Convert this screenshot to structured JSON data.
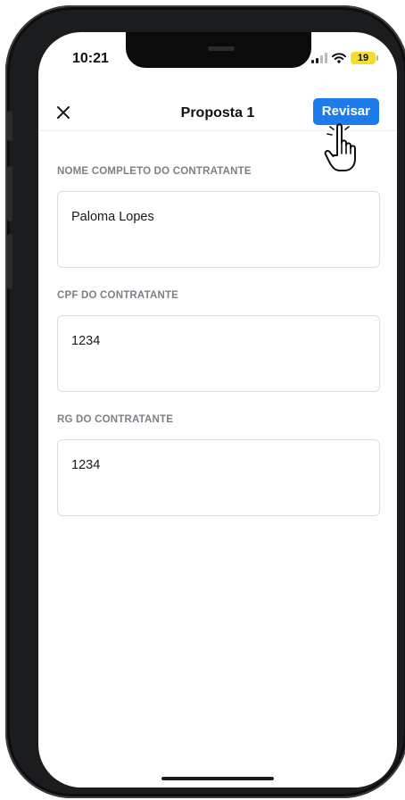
{
  "status": {
    "time": "10:21",
    "battery": "19"
  },
  "header": {
    "title": "Proposta 1",
    "review_label": "Revisar"
  },
  "fields": [
    {
      "label": "NOME COMPLETO DO CONTRATANTE",
      "value": "Paloma Lopes"
    },
    {
      "label": "CPF DO CONTRATANTE",
      "value": "1234"
    },
    {
      "label": "RG DO CONTRATANTE",
      "value": "1234"
    }
  ],
  "colors": {
    "accent": "#1d7bea",
    "battery": "#f3df2b"
  },
  "icons": [
    "close-icon",
    "signal-icon",
    "wifi-icon",
    "battery-icon",
    "hand-pointer-icon"
  ]
}
